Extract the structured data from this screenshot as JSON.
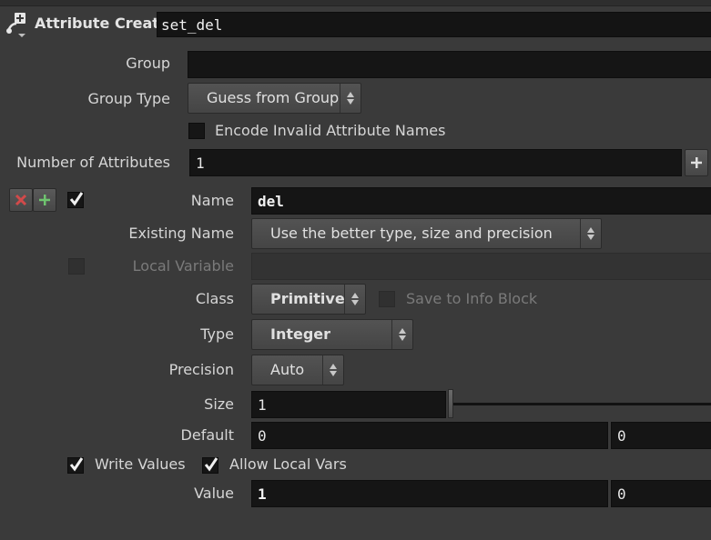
{
  "header": {
    "node_type": "Attribute Create",
    "node_name": "set_del",
    "icon": "attribute-create-icon"
  },
  "params": {
    "group_label": "Group",
    "group_value": "",
    "group_type_label": "Group Type",
    "group_type_value": "Guess from Group",
    "encode_label": "Encode Invalid Attribute Names",
    "encode_checked": false,
    "num_attr_label": "Number of Attributes",
    "num_attr_value": "1"
  },
  "attribute": {
    "name_label": "Name",
    "name_value": "del",
    "existing_label": "Existing Name",
    "existing_value": "Use the better type, size and precision",
    "local_var_label": "Local Variable",
    "local_var_value": "",
    "local_var_checked": false,
    "class_label": "Class",
    "class_value": "Primitive",
    "save_info_label": "Save to Info Block",
    "type_label": "Type",
    "type_value": "Integer",
    "precision_label": "Precision",
    "precision_value": "Auto",
    "size_label": "Size",
    "size_value": "1",
    "default_label": "Default",
    "default_values": [
      "0",
      "0"
    ],
    "write_values_label": "Write Values",
    "write_values_checked": true,
    "allow_local_label": "Allow Local Vars",
    "allow_local_checked": true,
    "value_label": "Value",
    "values": [
      "1",
      "0"
    ]
  },
  "colors": {
    "background": "#3a3a3a",
    "field": "#151515",
    "remove_red": "#d24a4a",
    "add_green": "#6fc46f"
  }
}
